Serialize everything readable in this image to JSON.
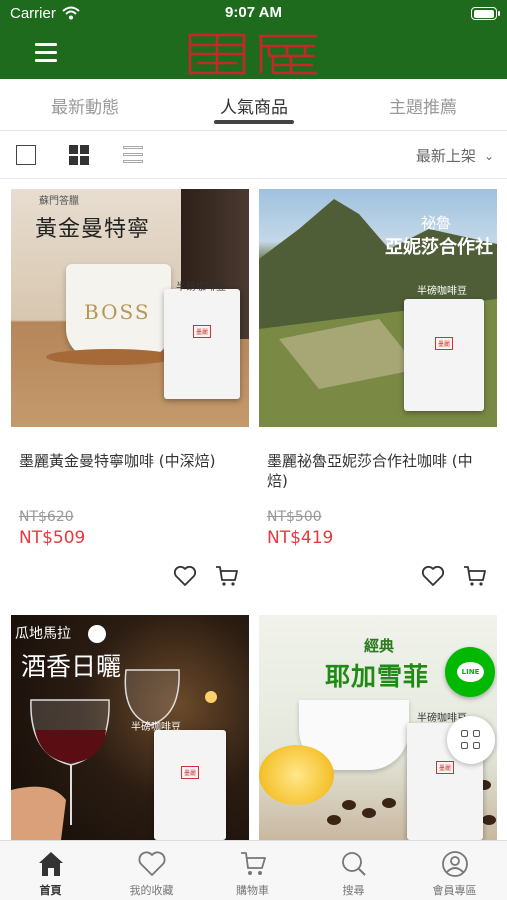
{
  "status_bar": {
    "carrier": "Carrier",
    "time": "9:07 AM"
  },
  "header": {
    "logo_text": "墨麗",
    "menu_icon": "hamburger-icon",
    "brand_color": "#1e6b1d",
    "logo_color": "#c62828"
  },
  "tabs": [
    {
      "label": "最新動態",
      "active": false
    },
    {
      "label": "人氣商品",
      "active": true
    },
    {
      "label": "主題推薦",
      "active": false
    }
  ],
  "toolbar": {
    "sort_label": "最新上架",
    "view_modes": [
      "single-view-icon",
      "grid-view-icon",
      "list-view-icon"
    ]
  },
  "products": [
    {
      "name": "墨麗黃金曼特寧咖啡 (中深焙)",
      "original_price": "NT$620",
      "price": "NT$509",
      "image": {
        "tag": "蘇門答臘",
        "title": "黃金曼特寧",
        "mug_text": "BOSS",
        "bag_caption": "半磅咖啡豆"
      }
    },
    {
      "name": "墨麗祕魯亞妮莎合作社咖啡 (中焙)",
      "original_price": "NT$500",
      "price": "NT$419",
      "image": {
        "tag": "祕魯",
        "title": "亞妮莎合作社",
        "bag_caption": "半磅咖啡豆"
      }
    },
    {
      "name": "",
      "original_price": "",
      "price": "",
      "image": {
        "tag": "瓜地馬拉",
        "title": "酒香日曬",
        "bag_caption": "半磅咖啡豆"
      }
    },
    {
      "name": "",
      "original_price": "",
      "price": "",
      "image": {
        "tag": "經典",
        "title": "耶加雪菲",
        "bag_caption": "半磅咖啡豆"
      }
    }
  ],
  "floating": {
    "line_label": "LINE",
    "line_color": "#00b900"
  },
  "bottom_nav": [
    {
      "label": "首頁",
      "icon": "home-icon",
      "active": true
    },
    {
      "label": "我的收藏",
      "icon": "heart-icon",
      "active": false
    },
    {
      "label": "購物車",
      "icon": "cart-icon",
      "active": false
    },
    {
      "label": "搜尋",
      "icon": "search-icon",
      "active": false
    },
    {
      "label": "會員專區",
      "icon": "user-icon",
      "active": false
    }
  ],
  "colors": {
    "price_red": "#e8383d",
    "strike_gray": "#999999"
  }
}
